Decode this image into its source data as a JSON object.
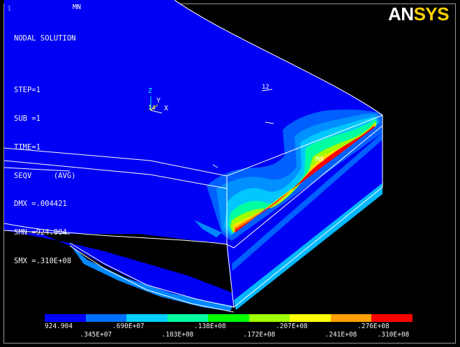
{
  "window": {
    "number": "1"
  },
  "info": {
    "title": "NODAL SOLUTION",
    "step": "STEP=1",
    "sub": "SUB =1",
    "time": "TIME=1",
    "result": "SEQV     (AVG)",
    "dmx": "DMX =.004421",
    "smn": "SMN =924.904",
    "smx": "SMX =.310E+08"
  },
  "logo": {
    "part1": "AN",
    "part2": "SYS"
  },
  "labels": {
    "min": "MN",
    "max": "MX",
    "node": "12"
  },
  "triad": {
    "z": "Z",
    "y": "Y",
    "x": "X",
    "origin": "14"
  },
  "legend": {
    "colors": [
      "#0000ff",
      "#0070ff",
      "#00d0ff",
      "#00ffa0",
      "#00ff00",
      "#a0ff00",
      "#ffff00",
      "#ffa000",
      "#ff0000"
    ],
    "top_labels": [
      "924.904",
      ".690E+07",
      ".138E+08",
      ".207E+08",
      ".276E+08"
    ],
    "bottom_labels": [
      ".345E+07",
      ".103E+08",
      ".172E+08",
      ".241E+08",
      ".310E+08"
    ]
  }
}
